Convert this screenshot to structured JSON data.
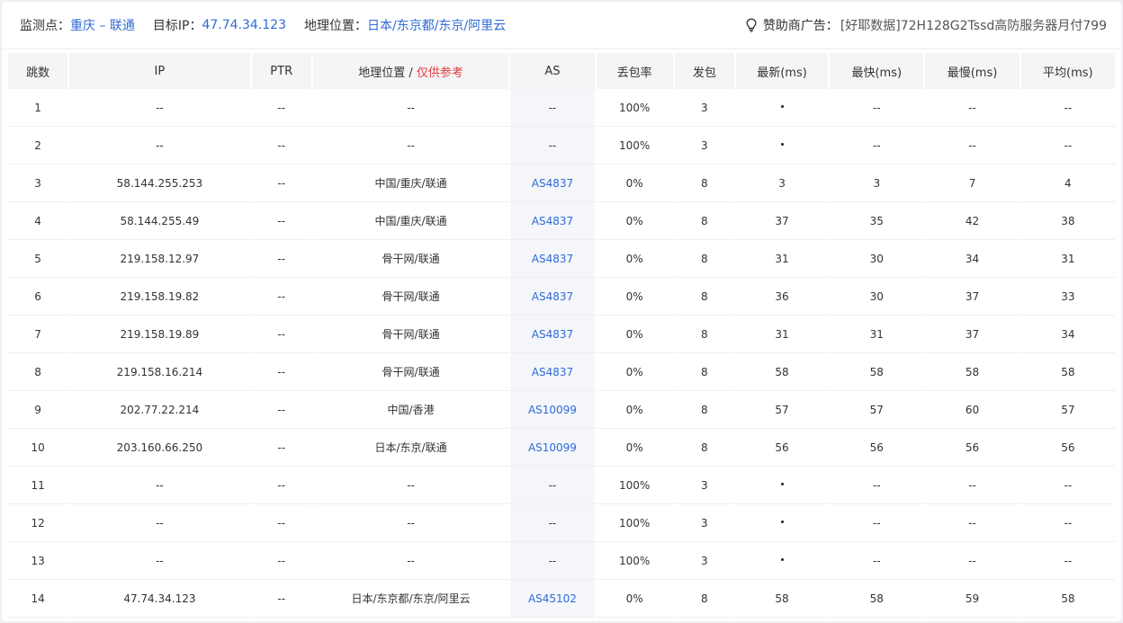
{
  "header": {
    "monitor_label": "监测点：",
    "monitor_value": "重庆 – 联通",
    "target_label": "目标IP：",
    "target_value": "47.74.34.123",
    "geo_label": "地理位置：",
    "geo_value": "日本/东京都/东京/阿里云",
    "sponsor_icon": "lightbulb-icon",
    "sponsor_label": "赞助商广告：",
    "sponsor_value": "[好耶数据]72H128G2Tssd高防服务器月付799"
  },
  "table": {
    "columns": {
      "hop": "跳数",
      "ip": "IP",
      "ptr": "PTR",
      "geo": "地理位置",
      "geo_sep": " / ",
      "geo_ref": "仅供参考",
      "as": "AS",
      "loss": "丢包率",
      "sent": "发包",
      "last": "最新(ms)",
      "best": "最快(ms)",
      "worst": "最慢(ms)",
      "avg": "平均(ms)"
    },
    "rows": [
      {
        "hop": "1",
        "ip": "--",
        "ptr": "--",
        "geo": "--",
        "as": "--",
        "loss": "100%",
        "sent": "3",
        "last": "*",
        "best": "--",
        "worst": "--",
        "avg": "--"
      },
      {
        "hop": "2",
        "ip": "--",
        "ptr": "--",
        "geo": "--",
        "as": "--",
        "loss": "100%",
        "sent": "3",
        "last": "*",
        "best": "--",
        "worst": "--",
        "avg": "--"
      },
      {
        "hop": "3",
        "ip": "58.144.255.253",
        "ptr": "--",
        "geo": "中国/重庆/联通",
        "as": "AS4837",
        "loss": "0%",
        "sent": "8",
        "last": "3",
        "best": "3",
        "worst": "7",
        "avg": "4"
      },
      {
        "hop": "4",
        "ip": "58.144.255.49",
        "ptr": "--",
        "geo": "中国/重庆/联通",
        "as": "AS4837",
        "loss": "0%",
        "sent": "8",
        "last": "37",
        "best": "35",
        "worst": "42",
        "avg": "38"
      },
      {
        "hop": "5",
        "ip": "219.158.12.97",
        "ptr": "--",
        "geo": "骨干网/联通",
        "as": "AS4837",
        "loss": "0%",
        "sent": "8",
        "last": "31",
        "best": "30",
        "worst": "34",
        "avg": "31"
      },
      {
        "hop": "6",
        "ip": "219.158.19.82",
        "ptr": "--",
        "geo": "骨干网/联通",
        "as": "AS4837",
        "loss": "0%",
        "sent": "8",
        "last": "36",
        "best": "30",
        "worst": "37",
        "avg": "33"
      },
      {
        "hop": "7",
        "ip": "219.158.19.89",
        "ptr": "--",
        "geo": "骨干网/联通",
        "as": "AS4837",
        "loss": "0%",
        "sent": "8",
        "last": "31",
        "best": "31",
        "worst": "37",
        "avg": "34"
      },
      {
        "hop": "8",
        "ip": "219.158.16.214",
        "ptr": "--",
        "geo": "骨干网/联通",
        "as": "AS4837",
        "loss": "0%",
        "sent": "8",
        "last": "58",
        "best": "58",
        "worst": "58",
        "avg": "58"
      },
      {
        "hop": "9",
        "ip": "202.77.22.214",
        "ptr": "--",
        "geo": "中国/香港",
        "as": "AS10099",
        "loss": "0%",
        "sent": "8",
        "last": "57",
        "best": "57",
        "worst": "60",
        "avg": "57"
      },
      {
        "hop": "10",
        "ip": "203.160.66.250",
        "ptr": "--",
        "geo": "日本/东京/联通",
        "as": "AS10099",
        "loss": "0%",
        "sent": "8",
        "last": "56",
        "best": "56",
        "worst": "56",
        "avg": "56"
      },
      {
        "hop": "11",
        "ip": "--",
        "ptr": "--",
        "geo": "--",
        "as": "--",
        "loss": "100%",
        "sent": "3",
        "last": "*",
        "best": "--",
        "worst": "--",
        "avg": "--"
      },
      {
        "hop": "12",
        "ip": "--",
        "ptr": "--",
        "geo": "--",
        "as": "--",
        "loss": "100%",
        "sent": "3",
        "last": "*",
        "best": "--",
        "worst": "--",
        "avg": "--"
      },
      {
        "hop": "13",
        "ip": "--",
        "ptr": "--",
        "geo": "--",
        "as": "--",
        "loss": "100%",
        "sent": "3",
        "last": "*",
        "best": "--",
        "worst": "--",
        "avg": "--"
      },
      {
        "hop": "14",
        "ip": "47.74.34.123",
        "ptr": "--",
        "geo": "日本/东京都/东京/阿里云",
        "as": "AS45102",
        "loss": "0%",
        "sent": "8",
        "last": "58",
        "best": "58",
        "worst": "59",
        "avg": "58"
      }
    ]
  },
  "colors": {
    "accent_blue": "#2f6bd8",
    "reference_red": "#e33a3a",
    "header_bg": "#f4f5f7",
    "as_cell_bg": "#f4f6fa"
  }
}
